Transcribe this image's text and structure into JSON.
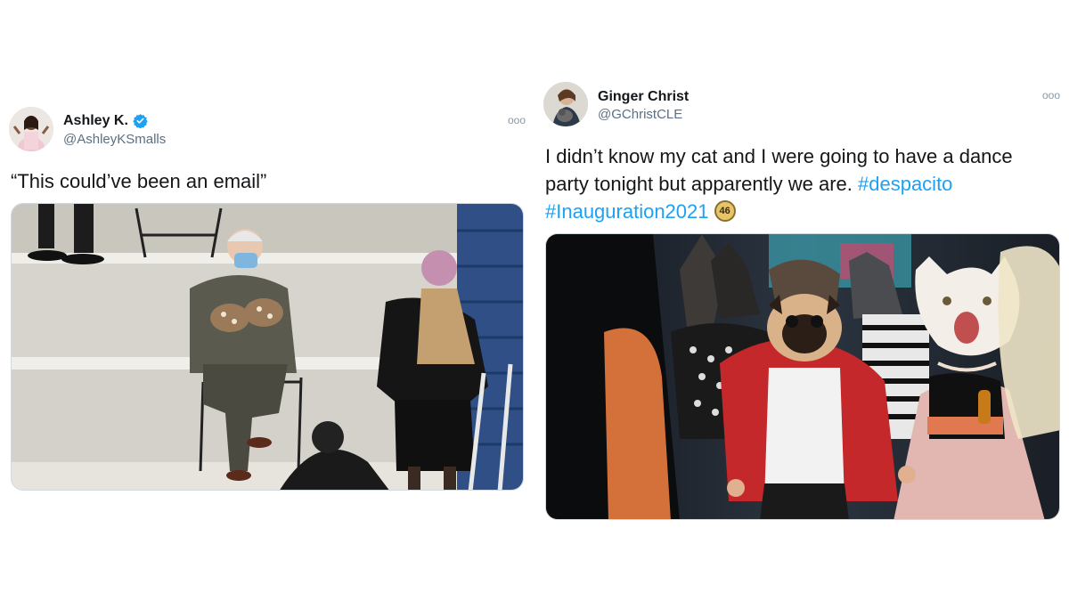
{
  "tweets": [
    {
      "display_name": "Ashley K.",
      "handle": "@AshleyKSmalls",
      "verified": true,
      "text": "“This could’ve been an email”",
      "more_label": "ooo"
    },
    {
      "display_name": "Ginger Christ",
      "handle": "@GChristCLE",
      "verified": false,
      "text_plain": "I didn’t know my cat and I were going to have a dance party tonight but apparently we are. ",
      "hashtag_1": "#despacito",
      "hashtag_2": "#Inauguration2021",
      "emoji_badge": "46",
      "more_label": "ooo"
    }
  ],
  "colors": {
    "hashtag": "#1da1f2",
    "verified": "#1da1f2",
    "handle": "#5b7083"
  },
  "icons": [
    "verified-badge-icon",
    "more-options-icon",
    "inauguration-46-emoji-icon"
  ]
}
